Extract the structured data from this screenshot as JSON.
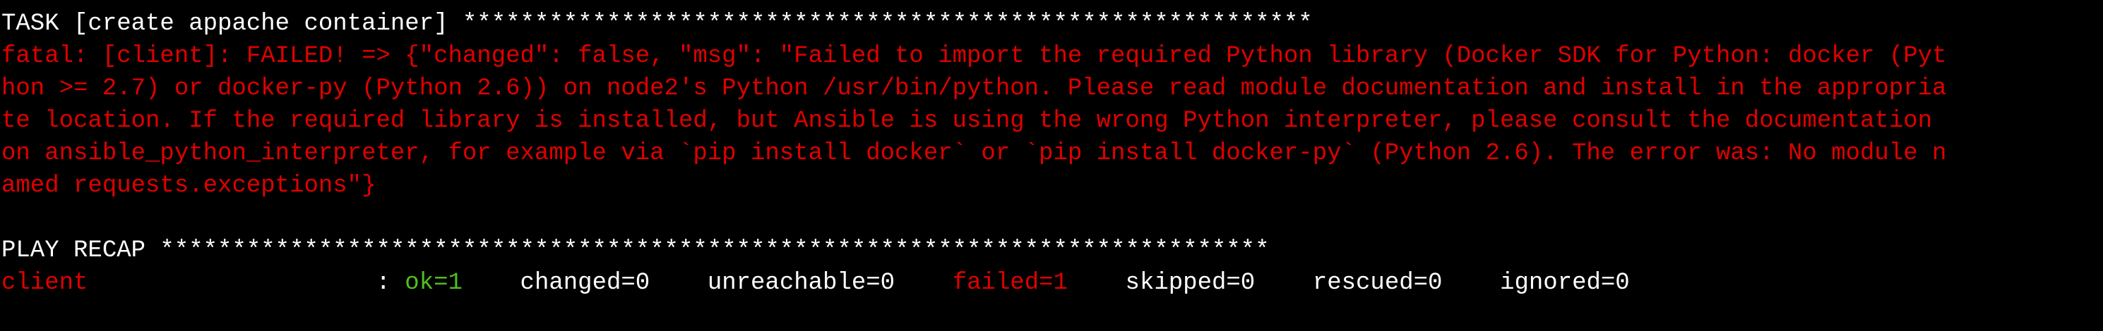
{
  "colors": {
    "background": "#000000",
    "default_text": "#ffffff",
    "error": "#e00000",
    "ok": "#4fbf1f"
  },
  "task": {
    "header": "TASK [create appache container] ***********************************************************"
  },
  "error_lines": [
    "fatal: [client]: FAILED! => {\"changed\": false, \"msg\": \"Failed to import the required Python library (Docker SDK for Python: docker (Pyt",
    "hon >= 2.7) or docker-py (Python 2.6)) on node2's Python /usr/bin/python. Please read module documentation and install in the appropria",
    "te location. If the required library is installed, but Ansible is using the wrong Python interpreter, please consult the documentation",
    "on ansible_python_interpreter, for example via `pip install docker` or `pip install docker-py` (Python 2.6). The error was: No module n",
    "amed requests.exceptions\"}"
  ],
  "recap": {
    "header": "PLAY RECAP *****************************************************************************",
    "host": "client",
    "separator": "                    : ",
    "ok": "ok=1",
    "gap1": "    ",
    "changed": "changed=0",
    "gap2": "    ",
    "unreachable": "unreachable=0",
    "gap3": "    ",
    "failed": "failed=1",
    "gap4": "    ",
    "skipped": "skipped=0",
    "gap5": "    ",
    "rescued": "rescued=0",
    "gap6": "    ",
    "ignored": "ignored=0"
  }
}
